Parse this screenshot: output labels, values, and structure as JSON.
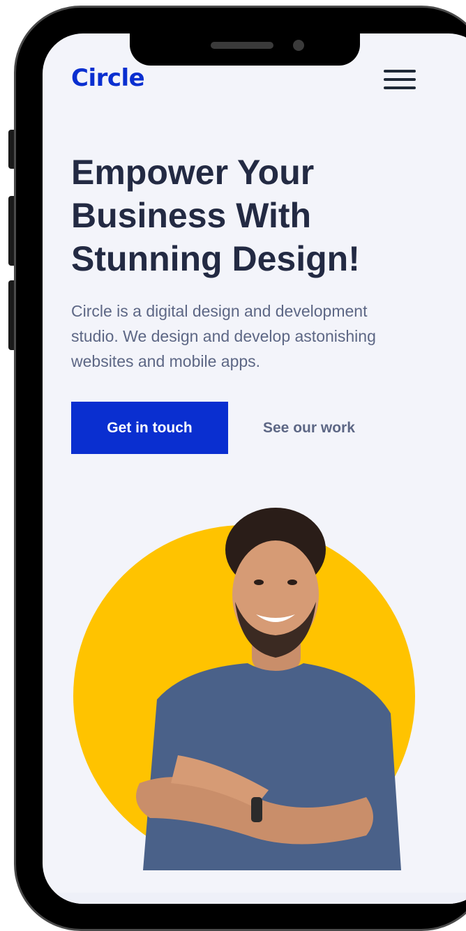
{
  "header": {
    "logo_text": "Circle",
    "menu_icon": "hamburger-menu-icon"
  },
  "hero": {
    "headline": "Empower Your Business With Stunning Design!",
    "description": "Circle is a digital design and development studio. We design and develop astonishing websites and mobile apps.",
    "primary_button_label": "Get in touch",
    "secondary_link_label": "See our work",
    "image_icon": "smiling-man-arms-crossed-photo"
  },
  "colors": {
    "brand_blue": "#0a2fd0",
    "accent_yellow": "#ffc300",
    "screen_background": "#f3f4fa",
    "heading": "#232a43",
    "body_text": "#5d6785"
  }
}
